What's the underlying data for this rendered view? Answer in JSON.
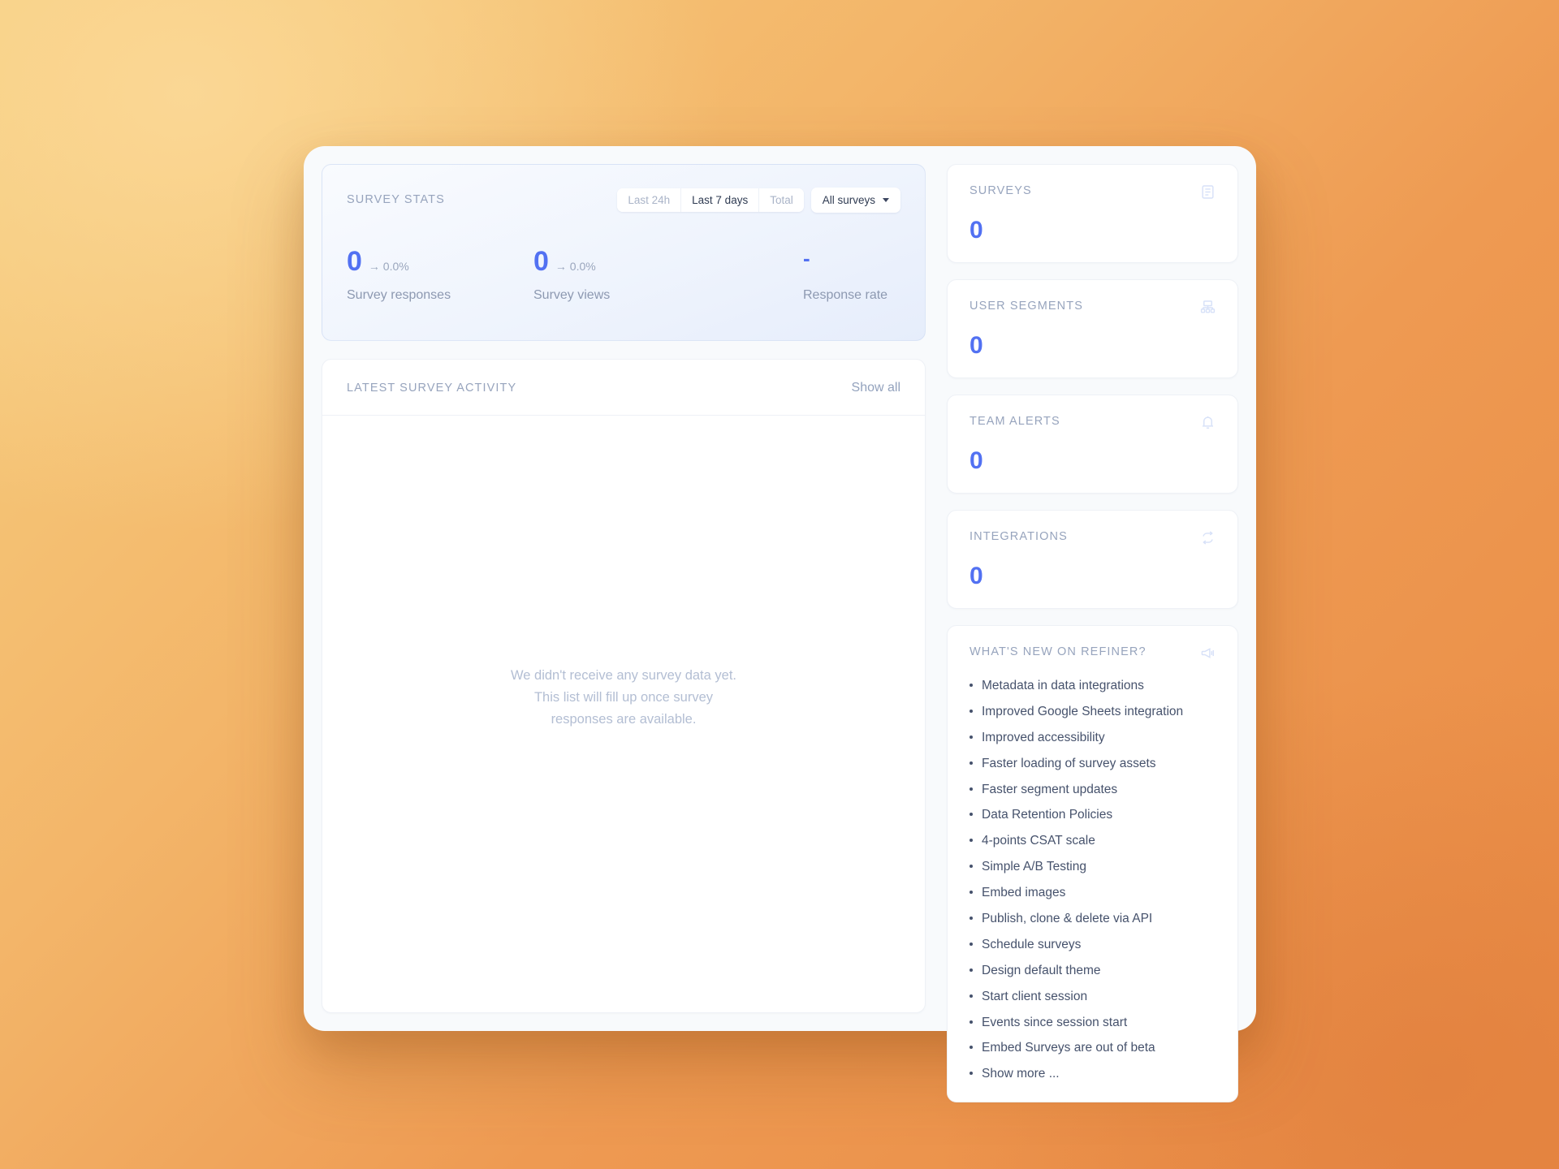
{
  "stats_panel": {
    "title": "SURVEY STATS",
    "range_options": [
      {
        "label": "Last 24h",
        "active": false
      },
      {
        "label": "Last 7 days",
        "active": true
      },
      {
        "label": "Total",
        "active": false
      }
    ],
    "survey_filter": "All surveys",
    "metrics": [
      {
        "value": "0",
        "delta": "→ 0.0%",
        "label": "Survey responses"
      },
      {
        "value": "0",
        "delta": "→ 0.0%",
        "label": "Survey views"
      },
      {
        "value": "-",
        "delta": "",
        "label": "Response rate"
      }
    ]
  },
  "activity_panel": {
    "title": "LATEST SURVEY ACTIVITY",
    "show_all": "Show all",
    "empty_line_1": "We didn't receive any survey data yet.",
    "empty_line_2": "This list will fill up once survey",
    "empty_line_3": "responses are available."
  },
  "metric_cards": [
    {
      "title": "SURVEYS",
      "value": "0",
      "icon": "document-list-icon"
    },
    {
      "title": "USER SEGMENTS",
      "value": "0",
      "icon": "sitemap-icon"
    },
    {
      "title": "TEAM ALERTS",
      "value": "0",
      "icon": "bell-icon"
    },
    {
      "title": "INTEGRATIONS",
      "value": "0",
      "icon": "sync-arrows-icon"
    }
  ],
  "news_card": {
    "title": "WHAT'S NEW ON REFINER?",
    "icon": "megaphone-icon",
    "items": [
      "Metadata in data integrations",
      "Improved Google Sheets integration",
      "Improved accessibility",
      "Faster loading of survey assets",
      "Faster segment updates",
      "Data Retention Policies",
      "4-points CSAT scale",
      "Simple A/B Testing",
      "Embed images",
      "Publish, clone & delete via API",
      "Schedule surveys",
      "Design default theme",
      "Start client session",
      "Events since session start",
      "Embed Surveys are out of beta",
      "Show more ..."
    ]
  },
  "colors": {
    "accent": "#5271f2",
    "icon_tint": "#d7e1f8",
    "text_muted": "#97a4bd",
    "background_start": "#f6cf7f",
    "background_end": "#e98a44"
  }
}
